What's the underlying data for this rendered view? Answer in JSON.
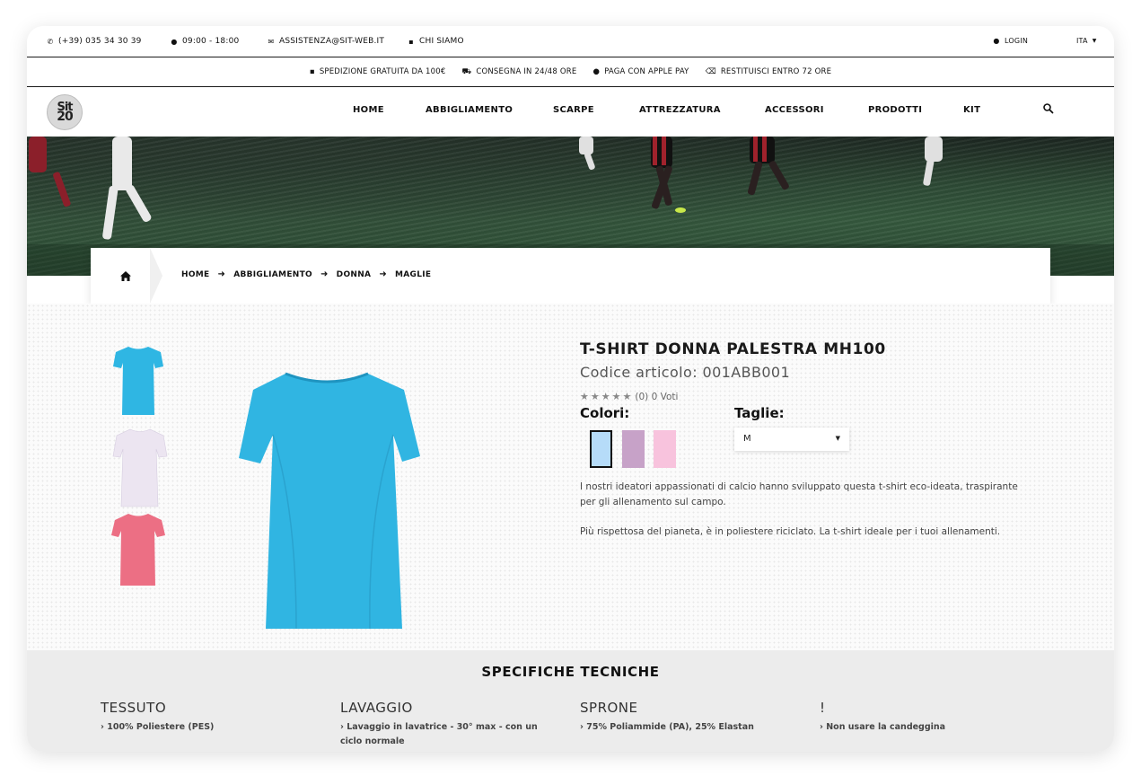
{
  "topbar": {
    "phone": "(+39) 035 34 30 39",
    "hours": "09:00 - 18:00",
    "email": "ASSISTENZA@SIT-WEB.IT",
    "about": "CHI SIAMO",
    "login": "LOGIN",
    "language": "ITA"
  },
  "shipbar": {
    "items": [
      {
        "icon": "box-icon",
        "label": "SPEDIZIONE GRATUITA DA 100€"
      },
      {
        "icon": "truck-icon",
        "label": "CONSEGNA IN 24/48 ORE"
      },
      {
        "icon": "apple-icon",
        "label": "PAGA CON APPLE PAY"
      },
      {
        "icon": "return-icon",
        "label": "RESTITUISCI ENTRO 72 ORE"
      }
    ]
  },
  "brand": {
    "line1": "Sit",
    "line2": "20"
  },
  "nav": {
    "items": [
      "HOME",
      "ABBIGLIAMENTO",
      "SCARPE",
      "ATTREZZATURA",
      "ACCESSORI",
      "PRODOTTI",
      "KIT"
    ]
  },
  "breadcrumb": {
    "items": [
      "HOME",
      "ABBIGLIAMENTO",
      "DONNA",
      "MAGLIE"
    ]
  },
  "product": {
    "title": "T-SHIRT DONNA PALESTRA MH100",
    "code": "Codice articolo: 001ABB001",
    "rating_text": "(0) 0 Voti",
    "rating_stars": 5,
    "colors_label": "Colori:",
    "sizes_label": "Taglie:",
    "selected_size": "M",
    "swatches": [
      "#b6dcf9",
      "#c7a2c8",
      "#f8c3dd"
    ],
    "thumb_colors": [
      "#2fb6e3",
      "#e9e2ef",
      "#ec6f84"
    ],
    "main_color": "#30b5e2",
    "description": [
      "I nostri ideatori appassionati di calcio hanno sviluppato questa t-shirt eco-ideata, traspirante per gli allenamento sul campo.",
      "Più rispettosa del pianeta, è in poliestere riciclato. La t-shirt ideale per i tuoi allenamenti."
    ]
  },
  "specs": {
    "title": "SPECIFICHE TECNICHE",
    "items": [
      {
        "heading": "TESSUTO",
        "value": "› 100% Poliestere (PES)"
      },
      {
        "heading": "LAVAGGIO",
        "value": "› Lavaggio in lavatrice - 30° max - con un ciclo normale"
      },
      {
        "heading": "SPRONE",
        "value": "› 75% Poliammide (PA), 25% Elastan"
      },
      {
        "heading": "!",
        "value": "› Non usare la candeggina"
      }
    ]
  }
}
